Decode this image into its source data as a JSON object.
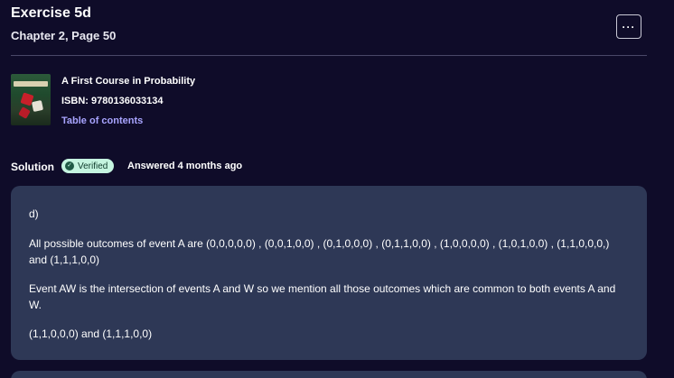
{
  "header": {
    "title": "Exercise 5d",
    "subtitle": "Chapter 2, Page 50",
    "more_label": "···"
  },
  "book": {
    "cover_icon": "book-cover-image",
    "title": "A First Course in Probability",
    "isbn": "ISBN: 9780136033134",
    "toc_link": "Table of contents"
  },
  "solution": {
    "label": "Solution",
    "badge": "Verified",
    "badge_icon": "check-badge-icon",
    "answered": "Answered 4 months ago",
    "paragraphs": [
      "d)",
      "All possible outcomes of event A are (0,0,0,0,0) , (0,0,1,0,0) , (0,1,0,0,0) , (0,1,1,0,0) , (1,0,0,0,0) , (1,0,1,0,0) , (1,1,0,0,0,) and (1,1,1,0,0)",
      "Event AW is the intersection of events A and W so we mention all those outcomes which are common to both events A and W.",
      "(1,1,0,0,0) and (1,1,1,0,0)"
    ]
  },
  "colors": {
    "background": "#0f0c29",
    "card": "#2e3856",
    "link": "#a8a4ff",
    "badge_bg": "#c5f5e0"
  }
}
